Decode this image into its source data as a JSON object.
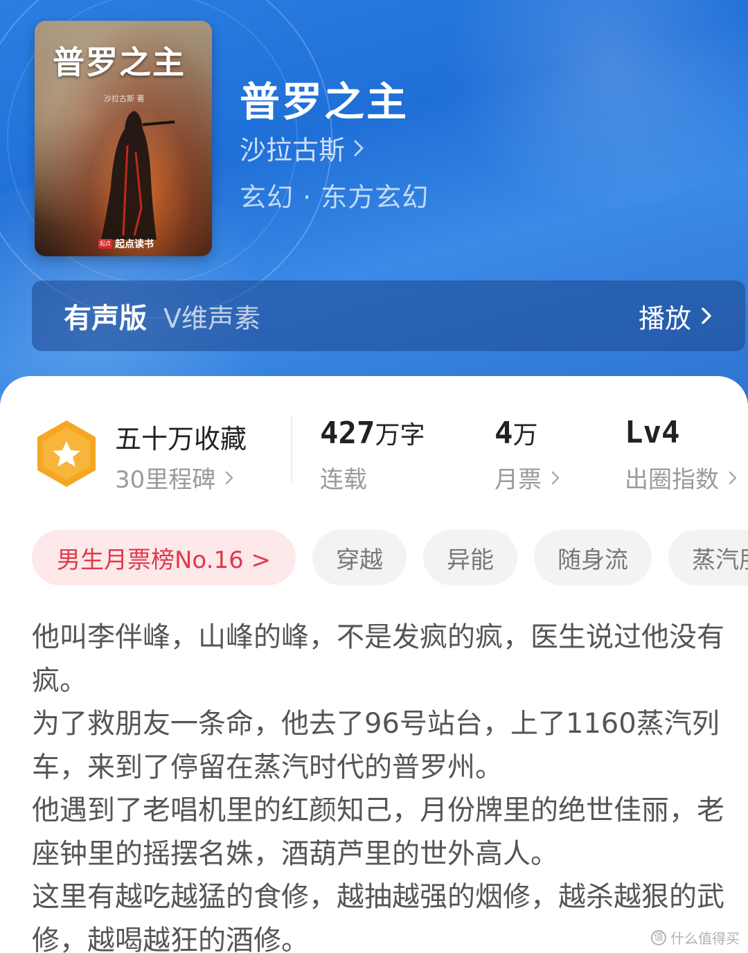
{
  "book": {
    "cover": {
      "title": "普罗之主",
      "author": "沙拉古斯 著",
      "publisher_badge": "起点",
      "publisher": "起点读书"
    },
    "title": "普罗之主",
    "author": "沙拉古斯",
    "genre": "玄幻 · 东方玄幻"
  },
  "audio": {
    "label": "有声版",
    "narrator": "V维声素",
    "play_label": "播放"
  },
  "stats": {
    "collection": {
      "title": "五十万收藏",
      "subtitle": "30里程碑"
    },
    "words": {
      "value": "427",
      "unit": "万字",
      "label": "连载"
    },
    "monthly_ticket": {
      "value": "4",
      "unit": "万",
      "label": "月票"
    },
    "index": {
      "value": "Lv4",
      "label": "出圈指数"
    }
  },
  "tags": [
    "男生月票榜No.16 >",
    "穿越",
    "异能",
    "随身流",
    "蒸汽朋"
  ],
  "description": [
    "他叫李伴峰，山峰的峰，不是发疯的疯，医生说过他没有疯。",
    "为了救朋友一条命，他去了96号站台，上了1160蒸汽列车，来到了停留在蒸汽时代的普罗州。",
    "他遇到了老唱机里的红颜知己，月份牌里的绝世佳丽，老座钟里的摇摆名姝，酒葫芦里的世外高人。",
    "这里有越吃越猛的食修，越抽越强的烟修，越杀越狠的武修，越喝越狂的酒修。"
  ],
  "watermark": {
    "icon": "值",
    "text": "什么值得买"
  },
  "colors": {
    "hero_blue": "#2b7fe0",
    "rank_red": "#e0394b",
    "rank_bg": "#fde8ea",
    "badge_orange": "#f5a623"
  }
}
